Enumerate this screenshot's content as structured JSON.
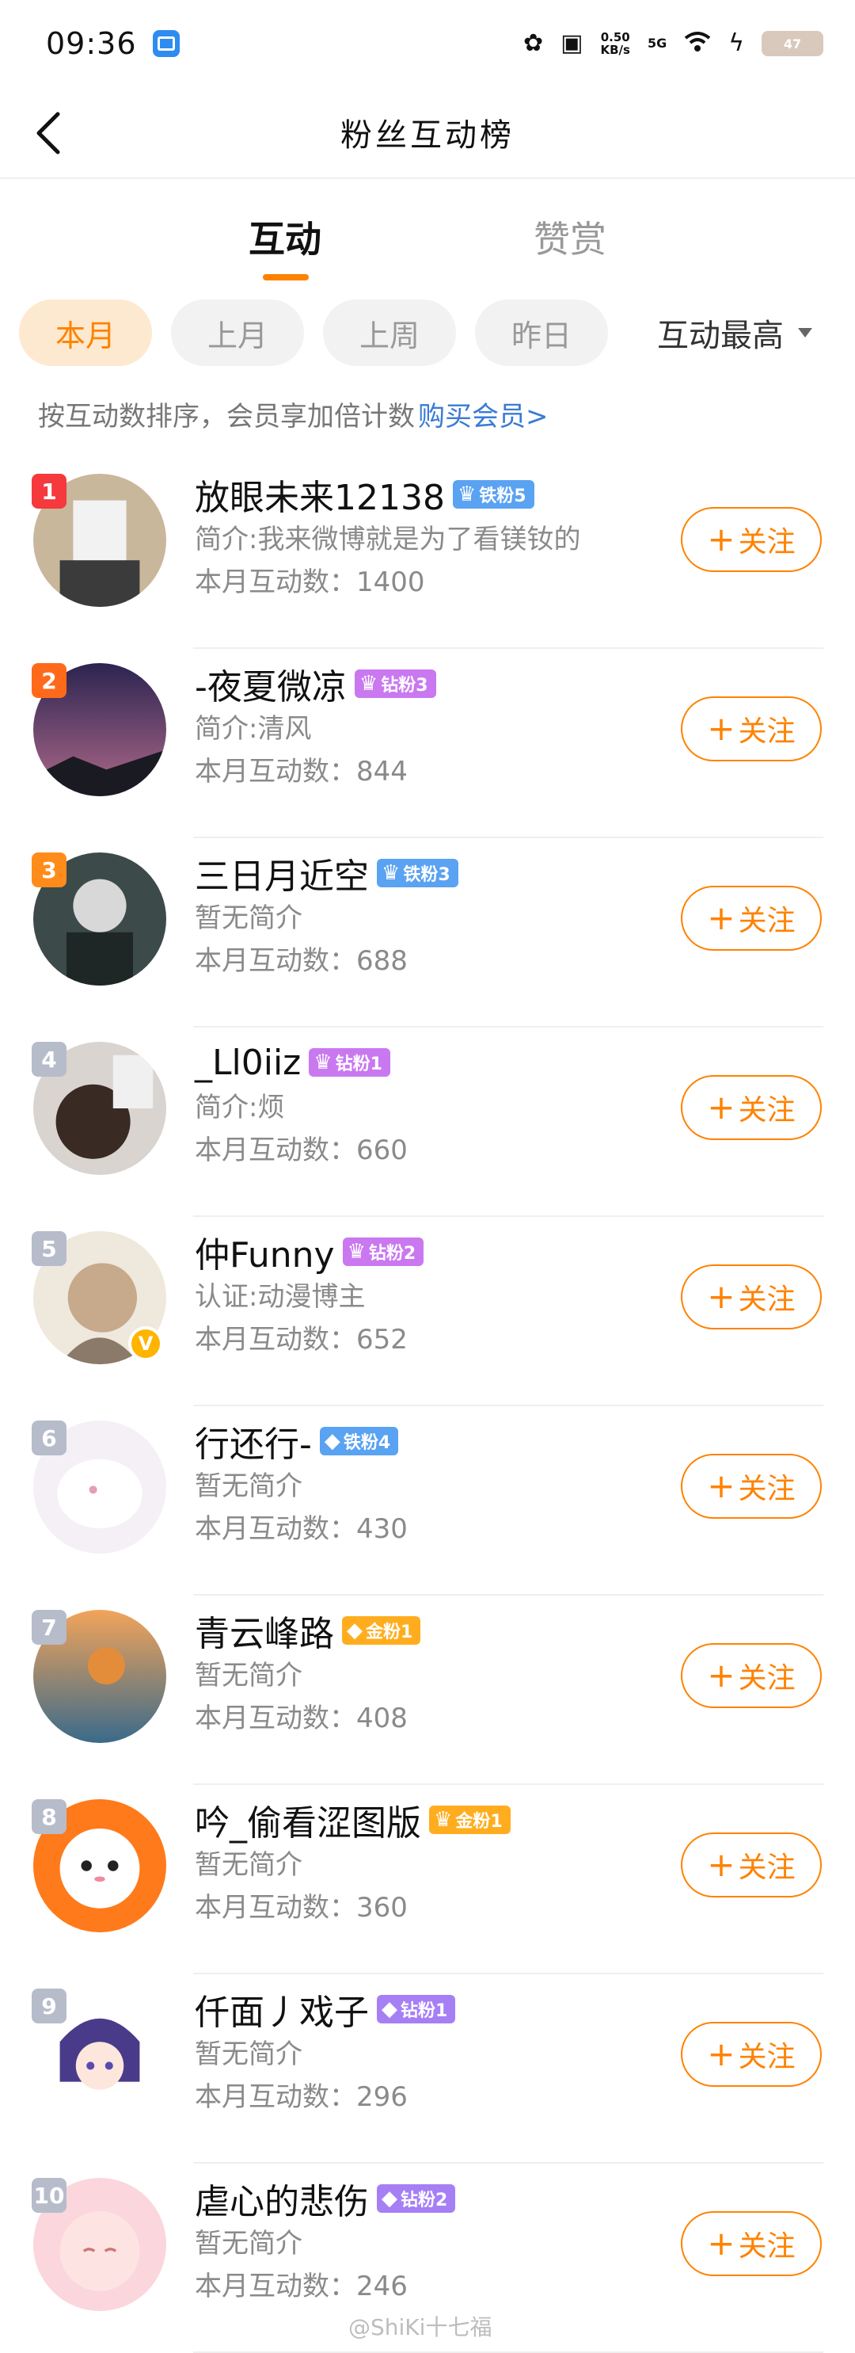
{
  "status_bar": {
    "time": "09:36",
    "speed_value": "0.50",
    "speed_unit": "KB/s",
    "network": "5G",
    "battery": "47"
  },
  "header": {
    "title": "粉丝互动榜"
  },
  "tabs": [
    {
      "label": "互动",
      "active": true
    },
    {
      "label": "赞赏",
      "active": false
    }
  ],
  "filters": {
    "chips": [
      "本月",
      "上月",
      "上周",
      "昨日"
    ],
    "active_index": 0,
    "sort_label": "互动最高"
  },
  "hint": {
    "text": "按互动数排序，会员享加倍计数",
    "link": "购买会员>"
  },
  "follow_label": "关注",
  "count_prefix": "本月互动数：",
  "colors": {
    "accent": "#ff8200",
    "rank_1": "#f5393c",
    "rank_2": "#ff6a1a",
    "rank_3": "#ff8c1a",
    "rank_other": "#b7bccb",
    "badge_iron": "#5aa2f2",
    "badge_diamond": "#c978f0",
    "badge_gold": "#ffad1f",
    "badge_purple": "#a67ff5"
  },
  "fans": [
    {
      "rank": "1",
      "name": "放眼未来12138",
      "badge": "铁粉5",
      "badge_color": "#5aa2f2",
      "crown": true,
      "desc": "简介:我来微博就是为了看镁钕的",
      "count": "1400",
      "verified": false
    },
    {
      "rank": "2",
      "name": "-夜夏微凉",
      "badge": "钻粉3",
      "badge_color": "#c978f0",
      "crown": true,
      "desc": "简介:清风",
      "count": "844",
      "verified": false
    },
    {
      "rank": "3",
      "name": "三日月近空",
      "badge": "铁粉3",
      "badge_color": "#5aa2f2",
      "crown": true,
      "desc": "暂无简介",
      "count": "688",
      "verified": false
    },
    {
      "rank": "4",
      "name": "_Ll0iiz",
      "badge": "钻粉1",
      "badge_color": "#c978f0",
      "crown": true,
      "desc": "简介:烦",
      "count": "660",
      "verified": false
    },
    {
      "rank": "5",
      "name": "仲Funny",
      "badge": "钻粉2",
      "badge_color": "#c978f0",
      "crown": true,
      "desc": "认证:动漫博主",
      "count": "652",
      "verified": true
    },
    {
      "rank": "6",
      "name": "行还行-",
      "badge": "铁粉4",
      "badge_color": "#5aa2f2",
      "crown": false,
      "desc": "暂无简介",
      "count": "430",
      "verified": false
    },
    {
      "rank": "7",
      "name": "青云峰路",
      "badge": "金粉1",
      "badge_color": "#ffad1f",
      "crown": false,
      "desc": "暂无简介",
      "count": "408",
      "verified": false
    },
    {
      "rank": "8",
      "name": "吟_偷看涩图版",
      "badge": "金粉1",
      "badge_color": "#ffad1f",
      "crown": true,
      "desc": "暂无简介",
      "count": "360",
      "verified": false
    },
    {
      "rank": "9",
      "name": "仟面丿戏子",
      "badge": "钻粉1",
      "badge_color": "#a67ff5",
      "crown": false,
      "desc": "暂无简介",
      "count": "296",
      "verified": false
    },
    {
      "rank": "10",
      "name": "虐心的悲伤",
      "badge": "钻粉2",
      "badge_color": "#a67ff5",
      "crown": false,
      "desc": "暂无简介",
      "count": "246",
      "verified": false
    }
  ],
  "watermark": "@ShiKi十七福"
}
